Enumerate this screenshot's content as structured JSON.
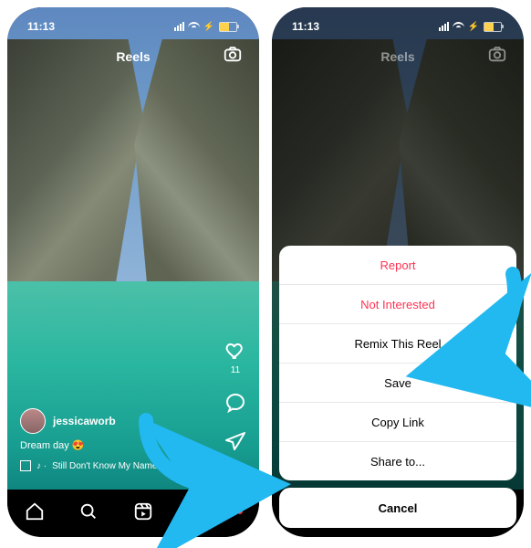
{
  "status": {
    "time": "11:13"
  },
  "header": {
    "title": "Reels"
  },
  "reel": {
    "like_count": "11",
    "username": "jessicaworb",
    "caption": "Dream day 😍",
    "audio_prefix": "♪ ·",
    "audio_track": "Still Don't Know My Name   La..."
  },
  "sheet": {
    "report": "Report",
    "not_interested": "Not Interested",
    "remix": "Remix This Reel",
    "save": "Save",
    "copy_link": "Copy Link",
    "share_to": "Share to...",
    "cancel": "Cancel"
  }
}
